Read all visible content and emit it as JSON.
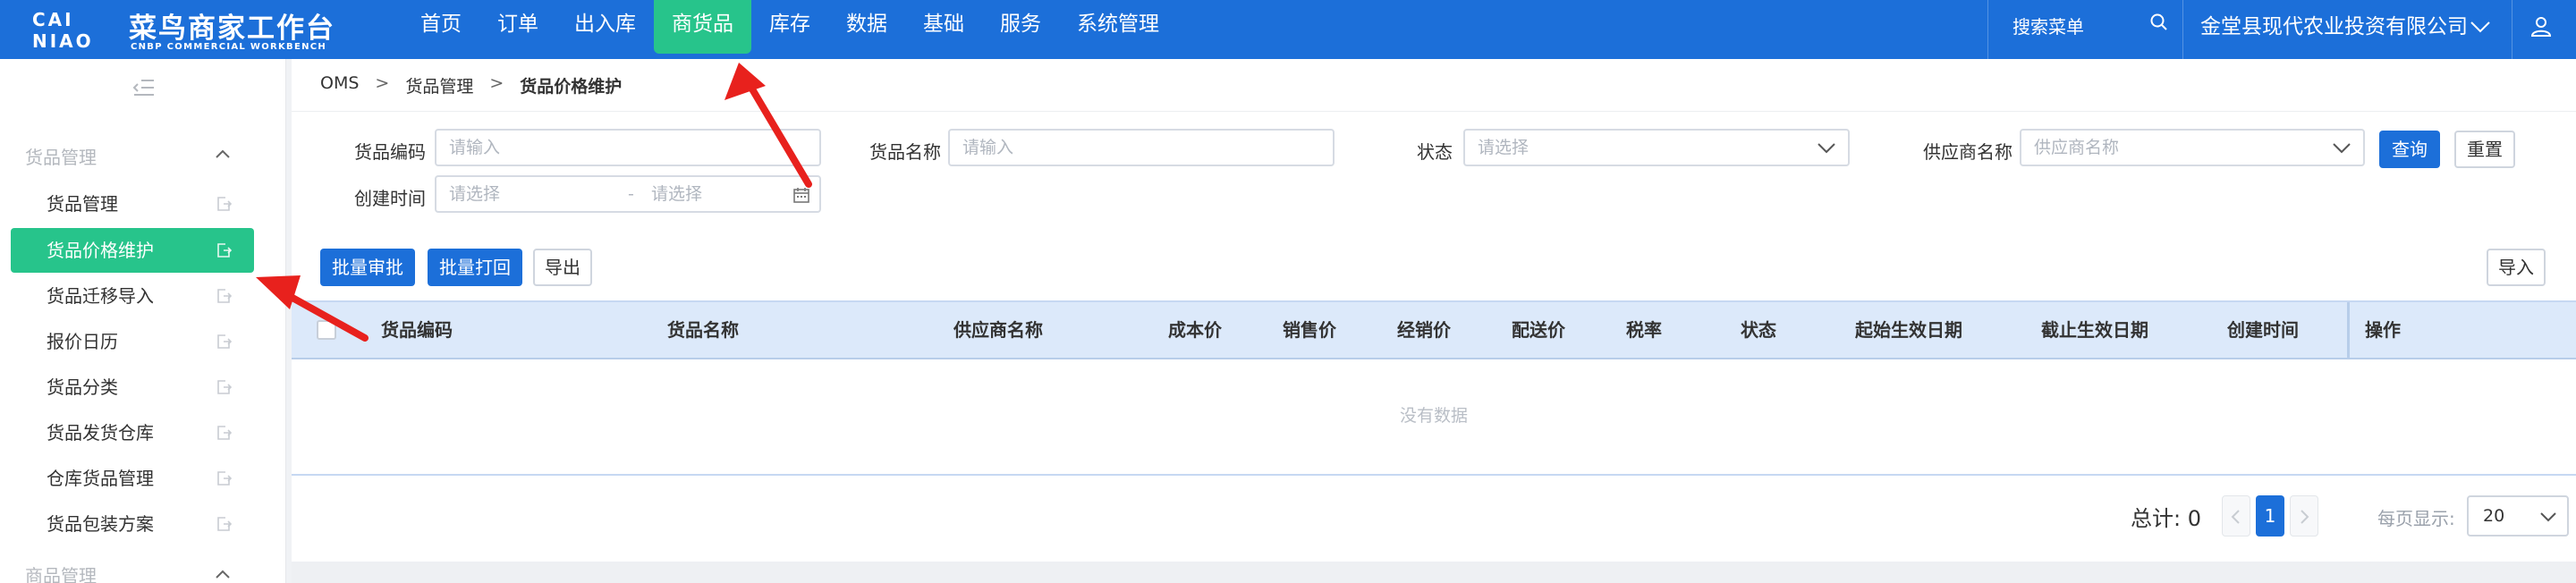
{
  "brand": {
    "mark_line1": "CAI",
    "mark_line2": "NIAO",
    "title": "菜鸟商家工作台",
    "subtitle": "CNBP COMMERCIAL WORKBENCH"
  },
  "nav": {
    "items": [
      {
        "label": "首页"
      },
      {
        "label": "订单"
      },
      {
        "label": "出入库"
      },
      {
        "label": "商货品",
        "active": true
      },
      {
        "label": "库存"
      },
      {
        "label": "数据"
      },
      {
        "label": "基础"
      },
      {
        "label": "服务"
      },
      {
        "label": "系统管理"
      }
    ]
  },
  "topbar": {
    "menu_search_placeholder": "搜索菜单",
    "company": "金堂县现代农业投资有限公司"
  },
  "sidebar": {
    "groups": [
      {
        "label": "货品管理",
        "expanded": true
      },
      {
        "label": "商品管理",
        "expanded": false
      }
    ],
    "items": [
      {
        "label": "货品管理"
      },
      {
        "label": "货品价格维护",
        "active": true
      },
      {
        "label": "货品迁移导入"
      },
      {
        "label": "报价日历"
      },
      {
        "label": "货品分类"
      },
      {
        "label": "货品发货仓库"
      },
      {
        "label": "仓库货品管理"
      },
      {
        "label": "货品包装方案"
      }
    ]
  },
  "breadcrumb": [
    "OMS",
    "货品管理",
    "货品价格维护"
  ],
  "filters": {
    "code_label": "货品编码",
    "code_placeholder": "请输入",
    "name_label": "货品名称",
    "name_placeholder": "请输入",
    "status_label": "状态",
    "status_placeholder": "请选择",
    "supplier_label": "供应商名称",
    "supplier_placeholder": "供应商名称",
    "created_label": "创建时间",
    "created_start_placeholder": "请选择",
    "created_sep": "-",
    "created_end_placeholder": "请选择",
    "search_btn": "查询",
    "reset_btn": "重置"
  },
  "actions": {
    "batch_approve": "批量审批",
    "batch_reject": "批量打回",
    "export": "导出",
    "import": "导入"
  },
  "table": {
    "columns": [
      "货品编码",
      "货品名称",
      "供应商名称",
      "成本价",
      "销售价",
      "经销价",
      "配送价",
      "税率",
      "状态",
      "起始生效日期",
      "截止生效日期",
      "创建时间",
      "操作"
    ],
    "empty_text": "没有数据"
  },
  "pagination": {
    "total_text": "总计: 0",
    "current_page": "1",
    "per_page_label": "每页显示:",
    "per_page_value": "20"
  },
  "colors": {
    "primary": "#1c6fd9",
    "accent_green": "#27c48b",
    "annotation_red": "#e8211d"
  }
}
